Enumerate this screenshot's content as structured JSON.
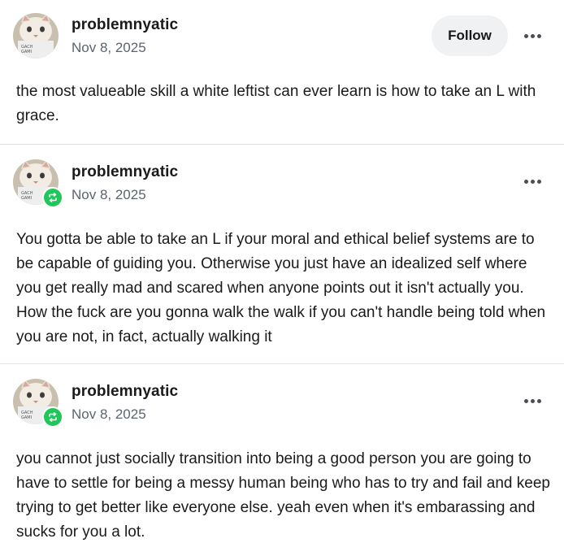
{
  "posts": [
    {
      "username": "problemnyatic",
      "date": "Nov 8, 2025",
      "follow_label": "Follow",
      "reblog": false,
      "text": "the most valueable skill a white leftist can ever learn is how to take an L with grace."
    },
    {
      "username": "problemnyatic",
      "date": "Nov 8, 2025",
      "reblog": true,
      "text": "You gotta be able to take an L if your moral and ethical belief systems are to be capable of guiding you. Otherwise you just have an idealized self where you get really mad and scared when anyone points out it isn't actually you. How the fuck are you gonna walk the walk if you can't handle being told when you are not, in fact, actually walking it"
    },
    {
      "username": "problemnyatic",
      "date": "Nov 8, 2025",
      "reblog": true,
      "text": "you cannot just socially transition into being a good person you are going to have to settle for being a messy human being who has to try and fail and keep trying to get better like everyone else. yeah even when it's embarassing and sucks for you a lot."
    }
  ],
  "icons": {
    "avatar": "cat-avatar-icon",
    "reblog_badge": "reblog-icon",
    "more": "more-options-icon"
  },
  "colors": {
    "reblog_green": "#1fc75a",
    "follow_bg": "#f0f1f3",
    "date_gray": "#5b6470",
    "divider": "#e3e3e3"
  }
}
